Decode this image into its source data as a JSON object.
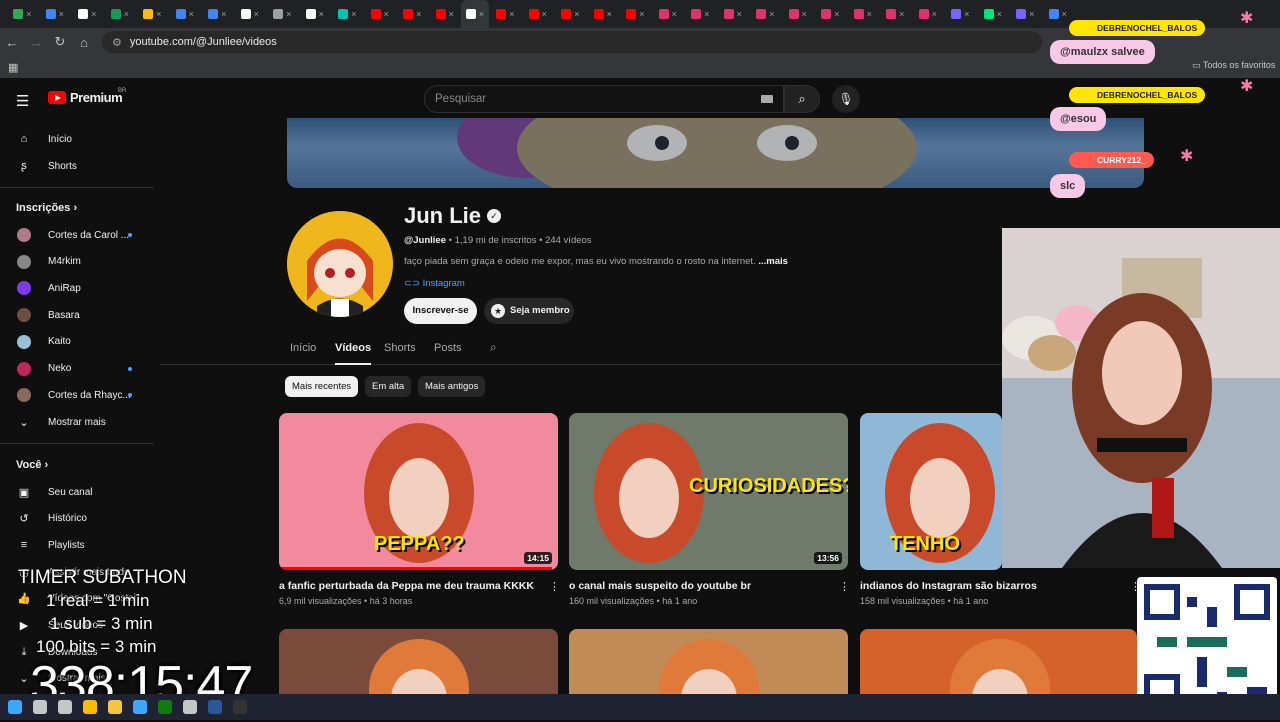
{
  "browser": {
    "url": "youtube.com/@Junliee/videos",
    "bookmarks_all": "Todos os favoritos",
    "tab_colors": [
      "#34a853",
      "#4285f4",
      "#ffffff",
      "#0f9d58",
      "#fbbc04",
      "#4285f4",
      "#4285f4",
      "#ffffff",
      "#9aa0a6",
      "#ffffff",
      "#00c4b4",
      "#ff0000",
      "#ff0000",
      "#ff0000",
      "#ffffff",
      "#ff0000",
      "#ff0000",
      "#ff0000",
      "#ff0000",
      "#ff0000",
      "#e1306c",
      "#e1306c",
      "#e1306c",
      "#e1306c",
      "#e1306c",
      "#e1306c",
      "#e1306c",
      "#e1306c",
      "#e1306c",
      "#7b61ff",
      "#00e676",
      "#7b61ff",
      "#4285f4"
    ]
  },
  "header": {
    "logo_text": "Premium",
    "logo_cc": "BR",
    "search_placeholder": "Pesquisar"
  },
  "sidebar": {
    "main": [
      {
        "label": "Início",
        "icon": "home-icon"
      },
      {
        "label": "Shorts",
        "icon": "shorts-icon"
      }
    ],
    "subs_title": "Inscrições",
    "subs": [
      {
        "label": "Cortes da Carol ...",
        "color": "#b07a8a",
        "live": true
      },
      {
        "label": "M4rkim",
        "color": "#888888",
        "live": false
      },
      {
        "label": "AniRap",
        "color": "#7c3aed",
        "live": false
      },
      {
        "label": "Basara",
        "color": "#6b4e3d",
        "live": false
      },
      {
        "label": "Kaito",
        "color": "#9ac0d8",
        "live": false
      },
      {
        "label": "Neko",
        "color": "#c0265a",
        "live": true
      },
      {
        "label": "Cortes da Rhayc...",
        "color": "#8a6a5a",
        "live": true
      }
    ],
    "show_more": "Mostrar mais",
    "you_title": "Você",
    "you": [
      {
        "label": "Seu canal",
        "icon": "channel-icon"
      },
      {
        "label": "Histórico",
        "icon": "history-icon"
      },
      {
        "label": "Playlists",
        "icon": "playlists-icon"
      },
      {
        "label": "Assistir mais tarde",
        "icon": "watch-later-icon"
      },
      {
        "label": "Vídeos com \"Gostei\"",
        "icon": "like-icon"
      },
      {
        "label": "Seus vídeos",
        "icon": "your-videos-icon"
      },
      {
        "label": "Downloads",
        "icon": "download-icon"
      },
      {
        "label": "Mostrar mais",
        "icon": "chevron-down-icon"
      }
    ]
  },
  "channel": {
    "name": "Jun Lie",
    "handle": "@Junliee",
    "subs": "1,19 mi de inscritos",
    "videos_count": "244 vídeos",
    "description": "faço piada sem graça e odeio me expor, mas eu vivo mostrando o rosto na internet.",
    "more": "...mais",
    "link": "Instagram",
    "subscribe": "Inscrever-se",
    "member": "Seja membro"
  },
  "tabs": [
    "Início",
    "Vídeos",
    "Shorts",
    "Posts"
  ],
  "chips": [
    "Mais recentes",
    "Em alta",
    "Mais antigos"
  ],
  "videos": [
    {
      "title": "a fanfic perturbada da Peppa me deu trauma KKKK",
      "views": "6,9 mil visualizações",
      "age": "há 3 horas",
      "duration": "14:15",
      "progress": 0.98,
      "overlay": "PEPPA??",
      "bg": "#f08a9c"
    },
    {
      "title": "o canal mais suspeito do youtube br",
      "views": "160 mil visualizações",
      "age": "há 1 ano",
      "duration": "13:56",
      "progress": 0.0,
      "overlay": "CURIOSIDADES?",
      "bg": "#6f7a6a"
    },
    {
      "title": "indianos do Instagram são bizarros",
      "views": "158 mil visualizações",
      "age": "há 1 ano",
      "duration": "",
      "progress": 0.0,
      "overlay": "TENHO",
      "bg": "#8fb7d6"
    }
  ],
  "videos_row2_colors": [
    "#7a4b3a",
    "#c08b57",
    "#d5622b"
  ],
  "overlay": {
    "timer_title": "TIMER SUBATHON",
    "rules": [
      "1 real = 1 min",
      "1 sub = 3 min",
      "100 bits = 3 min"
    ],
    "clock": "338:15:47",
    "chat": [
      {
        "user": "DEBRENOCHEL_BALOS",
        "msg": "@maulzx salvee"
      },
      {
        "user": "DEBRENOCHEL_BALOS",
        "msg": "@esou"
      },
      {
        "user": "CURRY212_",
        "msg": "slc"
      }
    ]
  }
}
